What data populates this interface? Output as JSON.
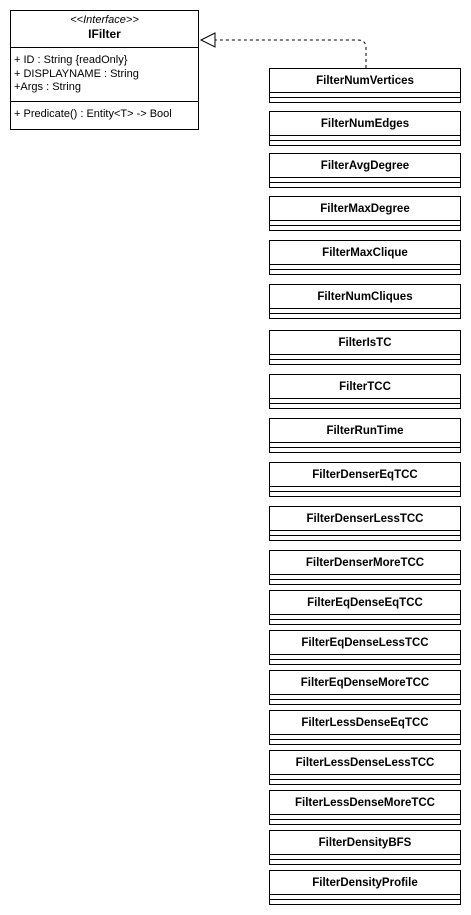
{
  "interface": {
    "stereotype": "<<Interface>>",
    "name": "IFilter",
    "attributes": [
      "+ ID : String {readOnly}",
      "+ DISPLAYNAME : String",
      "+Args : String"
    ],
    "operations": [
      "+ Predicate() : Entity<T> -> Bool"
    ]
  },
  "classes": [
    "FilterNumVertices",
    "FilterNumEdges",
    "FilterAvgDegree",
    "FilterMaxDegree",
    "FilterMaxClique",
    "FilterNumCliques",
    "FilterIsTC",
    "FilterTCC",
    "FilterRunTime",
    "FilterDenserEqTCC",
    "FilterDenserLessTCC",
    "FilterDenserMoreTCC",
    "FilterEqDenseEqTCC",
    "FilterEqDenseLessTCC",
    "FilterEqDenseMoreTCC",
    "FilterLessDenseEqTCC",
    "FilterLessDenseLessTCC",
    "FilterLessDenseMoreTCC",
    "FilterDensityBFS",
    "FilterDensityProfile"
  ]
}
